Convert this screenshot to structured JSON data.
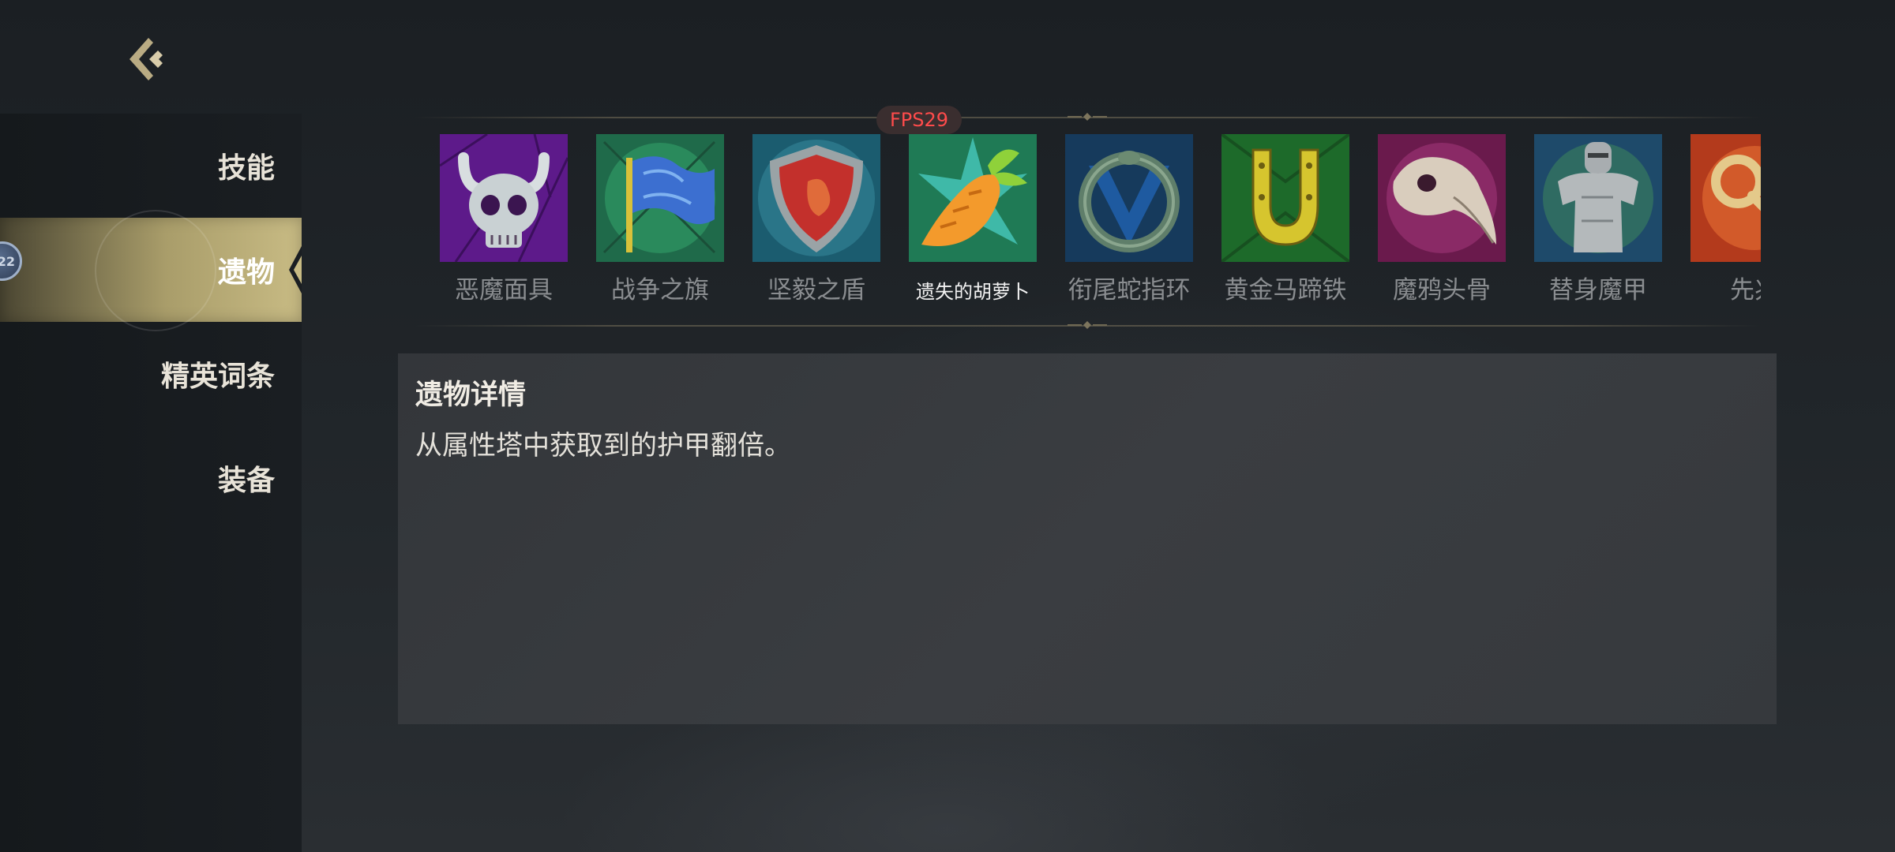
{
  "sidebar": {
    "items": [
      {
        "label": "技能"
      },
      {
        "label": "遗物"
      },
      {
        "label": "精英词条"
      },
      {
        "label": "装备"
      }
    ],
    "active_index": 1,
    "badge_text": "22"
  },
  "fps_label": "FPS29",
  "relics": [
    {
      "name": "恶魔面具",
      "icon": "demon-skull-icon"
    },
    {
      "name": "战争之旗",
      "icon": "war-flag-icon"
    },
    {
      "name": "坚毅之盾",
      "icon": "shield-icon"
    },
    {
      "name": "遗失的胡萝卜",
      "icon": "carrot-icon"
    },
    {
      "name": "衔尾蛇指环",
      "icon": "ouroboros-ring-icon"
    },
    {
      "name": "黄金马蹄铁",
      "icon": "horseshoe-icon"
    },
    {
      "name": "魔鸦头骨",
      "icon": "raven-skull-icon"
    },
    {
      "name": "替身魔甲",
      "icon": "armor-icon"
    },
    {
      "name": "先兆",
      "icon": "key-icon"
    }
  ],
  "selected_relic_index": 3,
  "detail": {
    "title": "遗物详情",
    "description": "从属性塔中获取到的护甲翻倍。"
  },
  "colors": {
    "accent_gold": "#c8bb84",
    "fps_red": "#ff4b4b"
  }
}
